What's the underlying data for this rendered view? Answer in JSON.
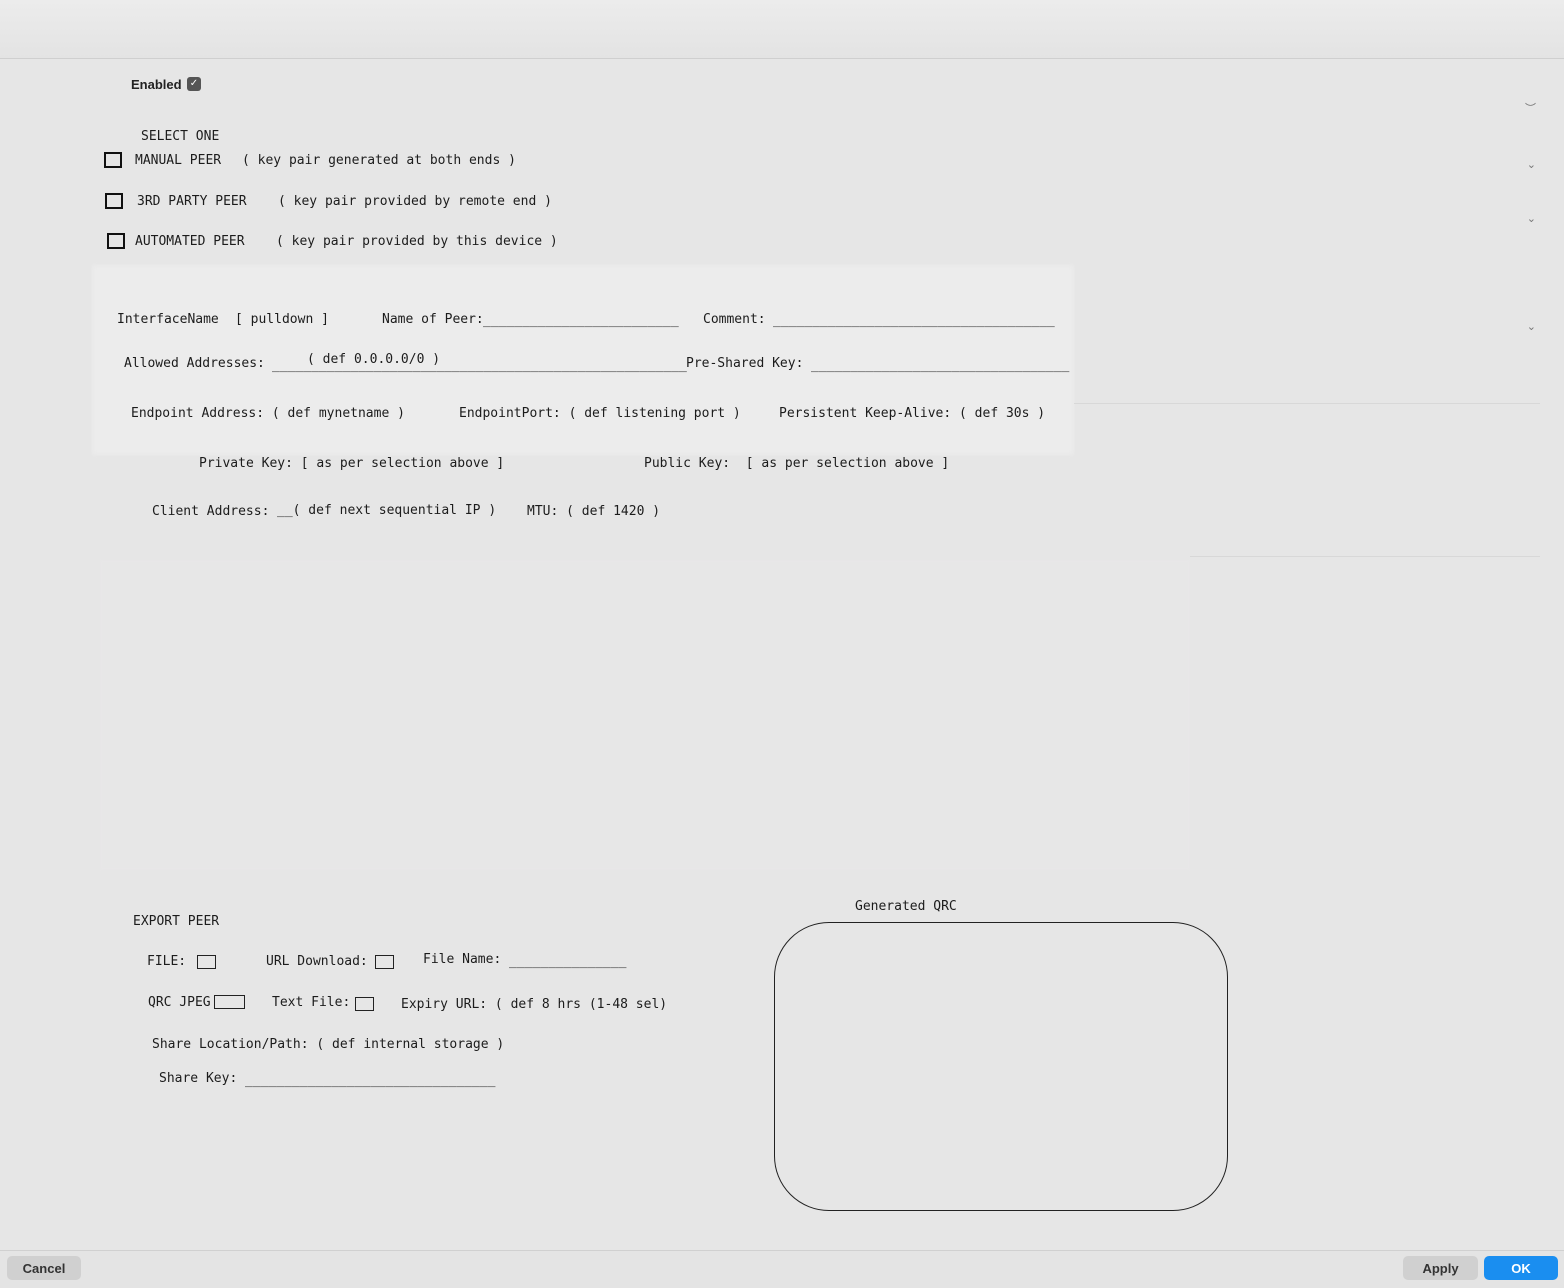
{
  "header": {
    "enabled_label": "Enabled",
    "enabled_checked": true
  },
  "selection": {
    "heading": "SELECT ONE",
    "options": [
      {
        "label": "MANUAL PEER",
        "desc": "( key pair generated at both ends )"
      },
      {
        "label": "3RD PARTY PEER",
        "desc": "( key pair provided by remote end )"
      },
      {
        "label": "AUTOMATED PEER",
        "desc": "( key pair provided by this device )"
      }
    ]
  },
  "peer_config": {
    "interface_label": "InterfaceName",
    "interface_value": "[ pulldown ]",
    "name_label": "Name of Peer:",
    "name_line": "_________________________",
    "comment_label": "Comment:",
    "comment_line": "____________________________________",
    "allowed_label": "Allowed Addresses:",
    "allowed_line": "_____________________________________________________",
    "allowed_default": "( def 0.0.0.0/0 )",
    "psk_label": "Pre-Shared Key:",
    "psk_line": "_________________________________",
    "endpoint_address": "Endpoint Address: ( def mynetname )",
    "endpoint_port": "EndpointPort: ( def listening port )",
    "keepalive": "Persistent Keep-Alive: ( def 30s )",
    "private_key": "Private Key: [ as per selection above ]",
    "public_key": "Public Key:  [ as per selection above ]",
    "client_label": "Client Address:",
    "client_value": "__( def next sequential IP )",
    "mtu": "MTU: ( def 1420 )"
  },
  "export": {
    "heading": "EXPORT PEER",
    "file_label": "FILE:",
    "url_download_label": "URL Download:",
    "file_name_label": "File Name:",
    "file_name_line": "_______________",
    "qrc_jpeg_label": "QRC JPEG",
    "text_file_label": "Text File:",
    "expiry_url": "Expiry URL: ( def 8 hrs (1-48 sel)",
    "share_location": "Share Location/Path: ( def internal storage )",
    "share_key_label": "Share Key:",
    "share_key_line": "________________________________"
  },
  "qr": {
    "title": "Generated QRC"
  },
  "footer": {
    "cancel": "Cancel",
    "apply": "Apply",
    "ok": "OK"
  },
  "icons": {
    "enabled_check": "checkmark-icon",
    "chevron": "chevron-down-icon"
  }
}
